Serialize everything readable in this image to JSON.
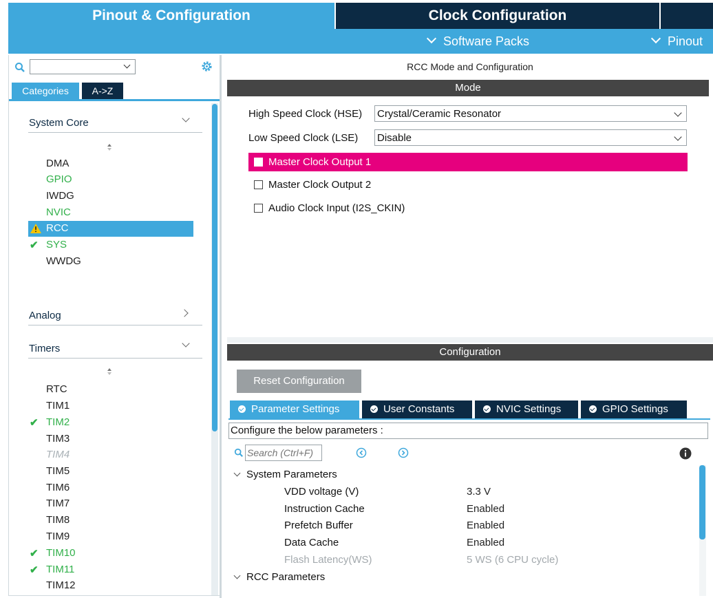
{
  "top_tabs": {
    "pinout_config": "Pinout & Configuration",
    "clock_config": "Clock Configuration"
  },
  "sub_menu": {
    "software_packs": "Software Packs",
    "pinout": "Pinout"
  },
  "left": {
    "search_value": "",
    "tabs": [
      "Categories",
      "A->Z"
    ],
    "categories": [
      {
        "name": "System Core",
        "expanded": true,
        "items": [
          {
            "label": "DMA",
            "state": "normal"
          },
          {
            "label": "GPIO",
            "state": "configured"
          },
          {
            "label": "IWDG",
            "state": "normal"
          },
          {
            "label": "NVIC",
            "state": "configured"
          },
          {
            "label": "RCC",
            "state": "warning-selected"
          },
          {
            "label": "SYS",
            "state": "checked"
          },
          {
            "label": "WWDG",
            "state": "normal"
          }
        ]
      },
      {
        "name": "Analog",
        "expanded": false
      },
      {
        "name": "Timers",
        "expanded": true,
        "items": [
          {
            "label": "RTC",
            "state": "normal"
          },
          {
            "label": "TIM1",
            "state": "normal"
          },
          {
            "label": "TIM2",
            "state": "checked"
          },
          {
            "label": "TIM3",
            "state": "normal"
          },
          {
            "label": "TIM4",
            "state": "disabled"
          },
          {
            "label": "TIM5",
            "state": "normal"
          },
          {
            "label": "TIM6",
            "state": "normal"
          },
          {
            "label": "TIM7",
            "state": "normal"
          },
          {
            "label": "TIM8",
            "state": "normal"
          },
          {
            "label": "TIM9",
            "state": "normal"
          },
          {
            "label": "TIM10",
            "state": "checked"
          },
          {
            "label": "TIM11",
            "state": "checked"
          },
          {
            "label": "TIM12",
            "state": "normal"
          }
        ]
      }
    ]
  },
  "mode": {
    "title": "RCC Mode and Configuration",
    "section": "Mode",
    "hse_label": "High Speed Clock (HSE)",
    "hse_value": "Crystal/Ceramic Resonator",
    "lse_label": "Low Speed Clock (LSE)",
    "lse_value": "Disable",
    "checkboxes": [
      {
        "label": "Master Clock Output 1",
        "highlighted": true,
        "checked": false
      },
      {
        "label": "Master Clock Output 2",
        "highlighted": false,
        "checked": false
      },
      {
        "label": "Audio Clock Input (I2S_CKIN)",
        "highlighted": false,
        "checked": false
      }
    ]
  },
  "configuration": {
    "section": "Configuration",
    "reset_button": "Reset Configuration",
    "tabs": [
      "Parameter Settings",
      "User Constants",
      "NVIC Settings",
      "GPIO Settings"
    ],
    "active_tab": "Parameter Settings",
    "hint": "Configure the below parameters :",
    "search_placeholder": "Search (Ctrl+F)",
    "groups": [
      {
        "name": "System Parameters",
        "params": [
          {
            "name": "VDD voltage (V)",
            "value": "3.3 V",
            "muted": false
          },
          {
            "name": "Instruction Cache",
            "value": "Enabled",
            "muted": false
          },
          {
            "name": "Prefetch Buffer",
            "value": "Enabled",
            "muted": false
          },
          {
            "name": "Data Cache",
            "value": "Enabled",
            "muted": false
          },
          {
            "name": "Flash Latency(WS)",
            "value": "5 WS (6 CPU cycle)",
            "muted": true
          }
        ]
      },
      {
        "name": "RCC Parameters",
        "params": []
      }
    ]
  },
  "colors": {
    "accent": "#3fa8dc",
    "navy": "#0c2a44",
    "highlight": "#e6007e",
    "configured_green": "#31b04a"
  }
}
